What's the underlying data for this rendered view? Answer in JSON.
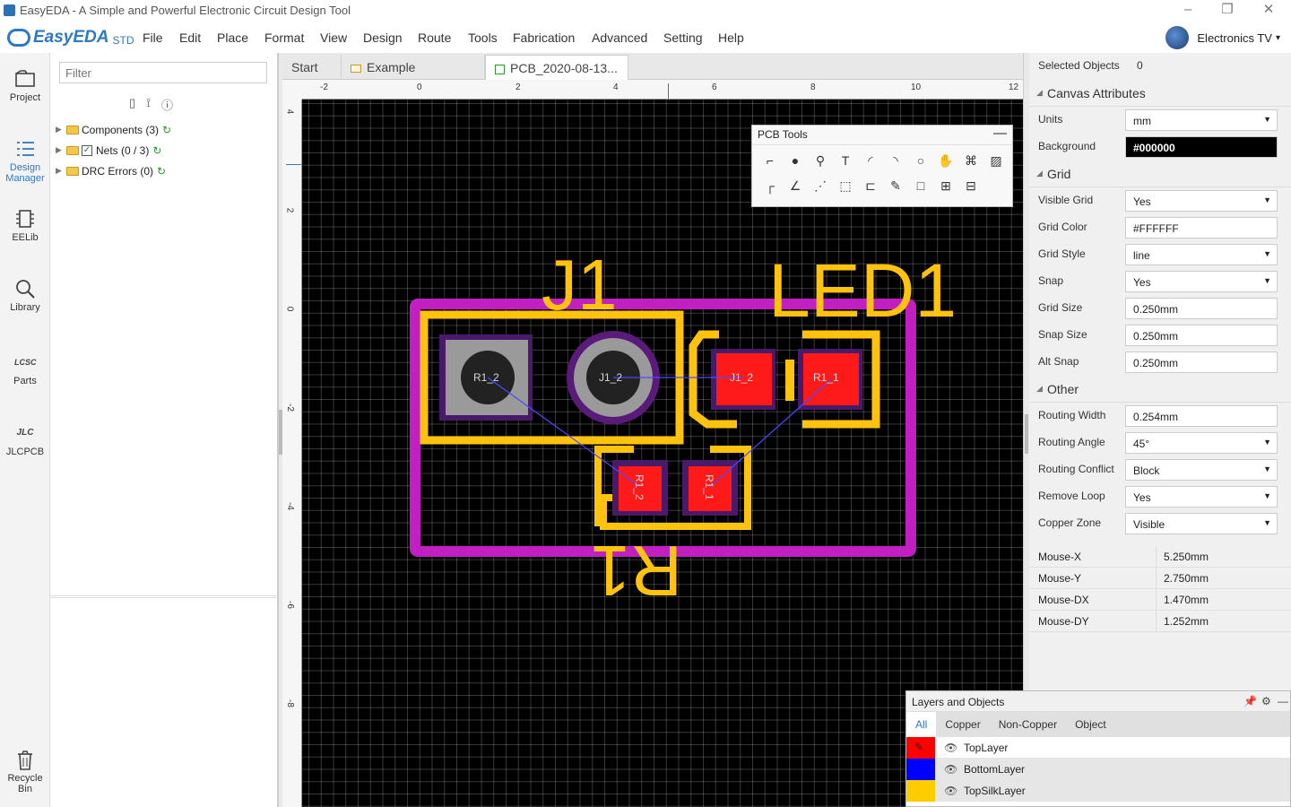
{
  "window": {
    "title": "EasyEDA - A Simple and Powerful Electronic Circuit Design Tool"
  },
  "logo": {
    "brand": "EasyEDA",
    "edition": "STD"
  },
  "menu": [
    "File",
    "Edit",
    "Place",
    "Format",
    "View",
    "Design",
    "Route",
    "Tools",
    "Fabrication",
    "Advanced",
    "Setting",
    "Help"
  ],
  "user": {
    "name": "Electronics TV",
    "caret": "▾"
  },
  "rail": [
    {
      "label": "Project",
      "icon": "project-icon"
    },
    {
      "label": "Design Manager",
      "icon": "design-manager-icon",
      "active": true
    },
    {
      "label": "EELib",
      "icon": "eelib-icon"
    },
    {
      "label": "Library",
      "icon": "library-icon"
    },
    {
      "label": "Parts",
      "icon": "parts-icon",
      "badge": "LCSC"
    },
    {
      "label": "JLCPCB",
      "icon": "jlcpcb-icon",
      "badge": "JLC"
    },
    {
      "label": "Recycle Bin",
      "icon": "recycle-bin-icon"
    }
  ],
  "design_manager": {
    "filter_placeholder": "Filter",
    "tree": [
      {
        "label": "Components (3)"
      },
      {
        "label": "Nets (0 / 3)",
        "checked": true
      },
      {
        "label": "DRC Errors (0)"
      }
    ]
  },
  "tabs": [
    {
      "label": "Start"
    },
    {
      "label": "Example"
    },
    {
      "label": "PCB_2020-08-13...",
      "active": true
    }
  ],
  "ruler": {
    "h": [
      "-2",
      "0",
      "2",
      "4",
      "6",
      "8",
      "10",
      "12"
    ],
    "v": [
      "4",
      "2",
      "0",
      "-2",
      "-4",
      "-6",
      "-8"
    ]
  },
  "pcb": {
    "designators": {
      "j1": "J1",
      "led1": "LED1",
      "r1": "R1"
    },
    "pads": {
      "r1_2a": "R1_2",
      "j1_2a": "J1_2",
      "j1_2b": "J1_2",
      "r1_1a": "R1_1",
      "r1_2b": "R1_2",
      "r1_1b": "R1_1"
    },
    "colors": {
      "board_outline": "#c21fc2",
      "silk": "#ffc20e",
      "pad": "#ff1a1a",
      "ratline": "#4a4aff"
    }
  },
  "pcb_tools": {
    "title": "PCB Tools",
    "min": "—"
  },
  "props": {
    "selected": {
      "label": "Selected Objects",
      "value": "0"
    },
    "sections": {
      "canvas": "Canvas Attributes",
      "grid": "Grid",
      "other": "Other"
    },
    "canvas": [
      {
        "label": "Units",
        "value": "mm",
        "dropdown": true
      },
      {
        "label": "Background",
        "value": "#000000",
        "dark": true
      }
    ],
    "grid": [
      {
        "label": "Visible Grid",
        "value": "Yes",
        "dropdown": true
      },
      {
        "label": "Grid Color",
        "value": "#FFFFFF"
      },
      {
        "label": "Grid Style",
        "value": "line",
        "dropdown": true
      },
      {
        "label": "Snap",
        "value": "Yes",
        "dropdown": true
      },
      {
        "label": "Grid Size",
        "value": "0.250mm"
      },
      {
        "label": "Snap Size",
        "value": "0.250mm"
      },
      {
        "label": "Alt Snap",
        "value": "0.250mm"
      }
    ],
    "other": [
      {
        "label": "Routing Width",
        "value": "0.254mm"
      },
      {
        "label": "Routing Angle",
        "value": "45°",
        "dropdown": true
      },
      {
        "label": "Routing Conflict",
        "value": "Block",
        "dropdown": true
      },
      {
        "label": "Remove Loop",
        "value": "Yes",
        "dropdown": true
      },
      {
        "label": "Copper Zone",
        "value": "Visible",
        "dropdown": true
      }
    ],
    "mouse": [
      {
        "label": "Mouse-X",
        "value": "5.250mm"
      },
      {
        "label": "Mouse-Y",
        "value": "2.750mm"
      },
      {
        "label": "Mouse-DX",
        "value": "1.470mm"
      },
      {
        "label": "Mouse-DY",
        "value": "1.252mm"
      }
    ]
  },
  "layers_panel": {
    "title": "Layers and Objects",
    "tabs": [
      "All",
      "Copper",
      "Non-Copper",
      "Object"
    ],
    "rows": [
      {
        "name": "TopLayer",
        "color": "#ff0000",
        "current": true
      },
      {
        "name": "BottomLayer",
        "color": "#0000ff"
      },
      {
        "name": "TopSilkLayer",
        "color": "#ffcc00"
      }
    ]
  }
}
